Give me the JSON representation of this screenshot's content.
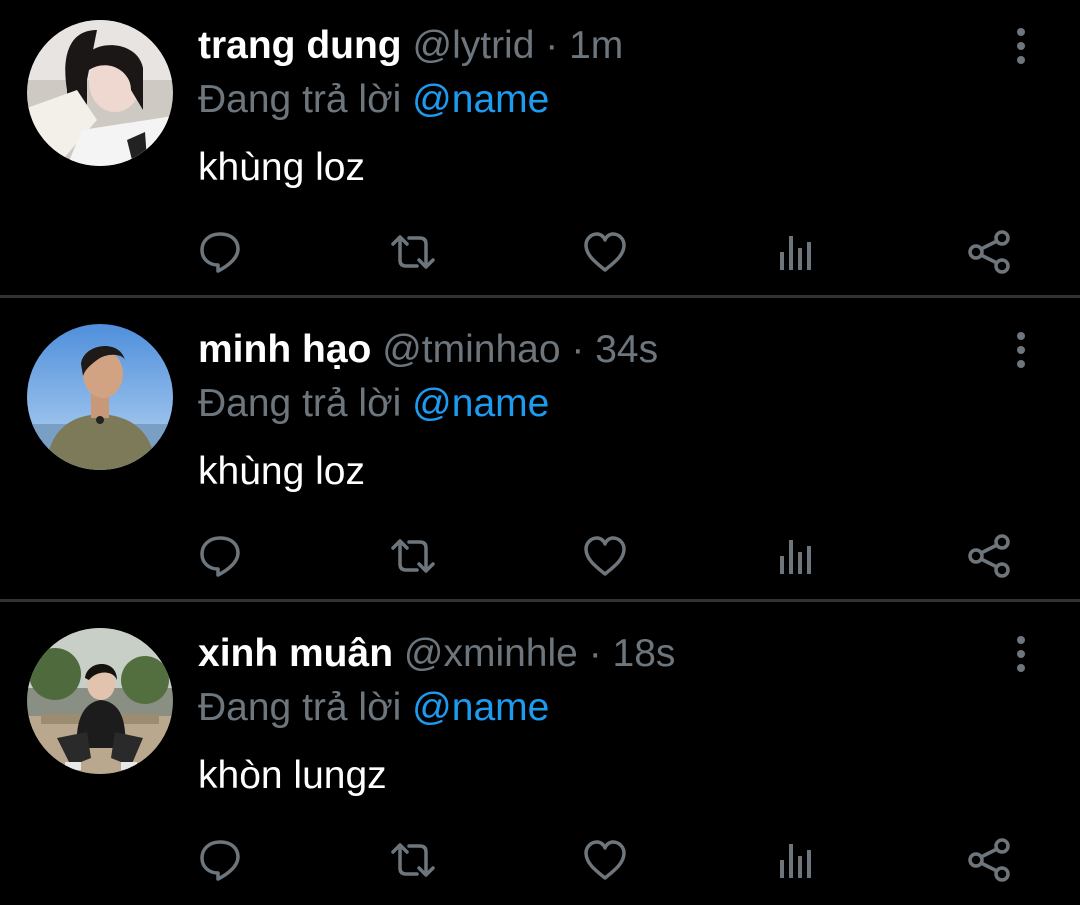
{
  "colors": {
    "background": "#000000",
    "text": "#ffffff",
    "muted": "#6e767d",
    "accent": "#1d9bf0",
    "divider": "#2f3336"
  },
  "tweets": [
    {
      "name": "trang dung",
      "handle": "@lytrid",
      "separator": "·",
      "time": "1m",
      "reply_prefix": "Đang trả lời",
      "reply_to": "@name",
      "text": "khùng loz"
    },
    {
      "name": "minh hạo",
      "handle": "@tminhao",
      "separator": "·",
      "time": "34s",
      "reply_prefix": "Đang trả lời",
      "reply_to": "@name",
      "text": "khùng loz"
    },
    {
      "name": "xinh muân",
      "handle": "@xminhle",
      "separator": "·",
      "time": "18s",
      "reply_prefix": "Đang trả lời",
      "reply_to": "@name",
      "text": "khòn lungz"
    }
  ],
  "icons": {
    "more": "more-vertical-icon",
    "reply": "reply-icon",
    "retweet": "retweet-icon",
    "like": "heart-icon",
    "analytics": "analytics-icon",
    "share": "share-icon"
  }
}
